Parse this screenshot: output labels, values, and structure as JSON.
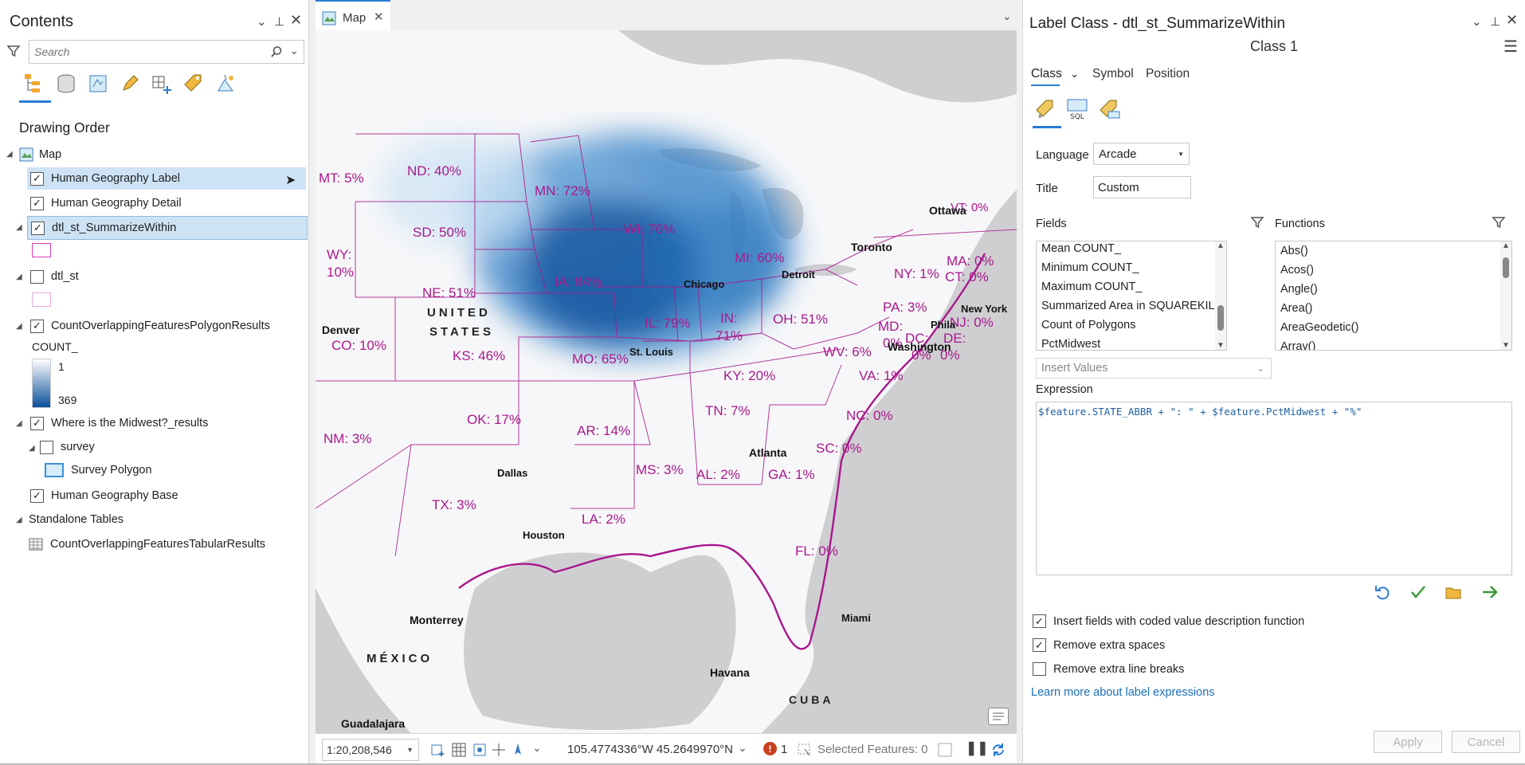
{
  "contents": {
    "title": "Contents",
    "search_placeholder": "Search",
    "drawing_order": "Drawing Order",
    "map_label": "Map",
    "layers": [
      {
        "label": "Human Geography Label"
      },
      {
        "label": "Human Geography Detail"
      },
      {
        "label": "dtl_st_SummarizeWithin"
      },
      {
        "label": "dtl_st"
      },
      {
        "label": "CountOverlappingFeaturesPolygonResults"
      },
      {
        "label": "Where is the Midwest?_results"
      },
      {
        "label": "survey"
      },
      {
        "label": "Survey Polygon"
      },
      {
        "label": "Human Geography Base"
      }
    ],
    "legend_field": "COUNT_",
    "legend_min": "1",
    "legend_max": "369",
    "standalone_tables": "Standalone Tables",
    "table_name": "CountOverlappingFeaturesTabularResults"
  },
  "map": {
    "tab_label": "Map",
    "state_labels": [
      "MT: 5%",
      "ND: 40%",
      "MN: 72%",
      "SD: 50%",
      "WI: 76%",
      "WY:",
      "10%",
      "MI: 60%",
      "NE: 51%",
      "IA: 84%",
      "IL: 79%",
      "IN:",
      "71%",
      "OH: 51%",
      "CO: 10%",
      "KS: 46%",
      "MO: 65%",
      "PA: 3%",
      "NY: 1%",
      "MA: 0%",
      "CT: 0%",
      "WV: 6%",
      "VA: 1%",
      "MD:",
      "0%",
      "DC:",
      "DE:",
      "0%",
      "0%",
      "NJ: 0%",
      "KY: 20%",
      "OK: 17%",
      "AR: 14%",
      "TN: 7%",
      "NC: 0%",
      "NM: 3%",
      "SC: 0%",
      "MS: 3%",
      "AL: 2%",
      "GA: 1%",
      "TX: 3%",
      "LA: 2%",
      "FL: 0%",
      "VT: 0%"
    ],
    "cities": [
      "Denver",
      "Chicago",
      "Detroit",
      "Toronto",
      "Ottawa",
      "New York",
      "Phila",
      "Washington",
      "St. Louis",
      "Atlanta",
      "Dallas",
      "Houston",
      "Miami",
      "Monterrey",
      "Havana",
      "Guadalajara"
    ],
    "countries": [
      "UNITED",
      "STATES",
      "MÉXICO",
      "CUBA"
    ],
    "scale": "1:20,208,546",
    "coordinates": "105.4774336°W 45.2649970°N",
    "error_count": "1",
    "selected_features": "Selected Features: 0"
  },
  "label_class": {
    "title": "Label Class - dtl_st_SummarizeWithin",
    "class_name": "Class 1",
    "tabs": [
      "Class",
      "Symbol",
      "Position"
    ],
    "language_label": "Language",
    "language_value": "Arcade",
    "title_label": "Title",
    "title_value": "Custom",
    "fields_label": "Fields",
    "functions_label": "Functions",
    "fields": [
      "Mean COUNT_",
      "Minimum COUNT_",
      "Maximum COUNT_",
      "Summarized Area in SQUAREKILOMETEF",
      "Count of Polygons",
      "PctMidwest"
    ],
    "functions": [
      "Abs()",
      "Acos()",
      "Angle()",
      "Area()",
      "AreaGeodetic()",
      "Array()"
    ],
    "insert_values": "Insert Values",
    "expression_label": "Expression",
    "expression": "$feature.STATE_ABBR + \": \" + $feature.PctMidwest + \"%\"",
    "checkboxes": [
      {
        "label": "Insert fields with coded value description function",
        "checked": true
      },
      {
        "label": "Remove extra spaces",
        "checked": true
      },
      {
        "label": "Remove extra line breaks",
        "checked": false
      }
    ],
    "learn_more": "Learn more about label expressions",
    "apply": "Apply",
    "cancel": "Cancel"
  },
  "colors": {
    "accent": "#2b7bd1",
    "label_magenta": "#a8188c",
    "midwest_dark": "#0b4f9a"
  }
}
